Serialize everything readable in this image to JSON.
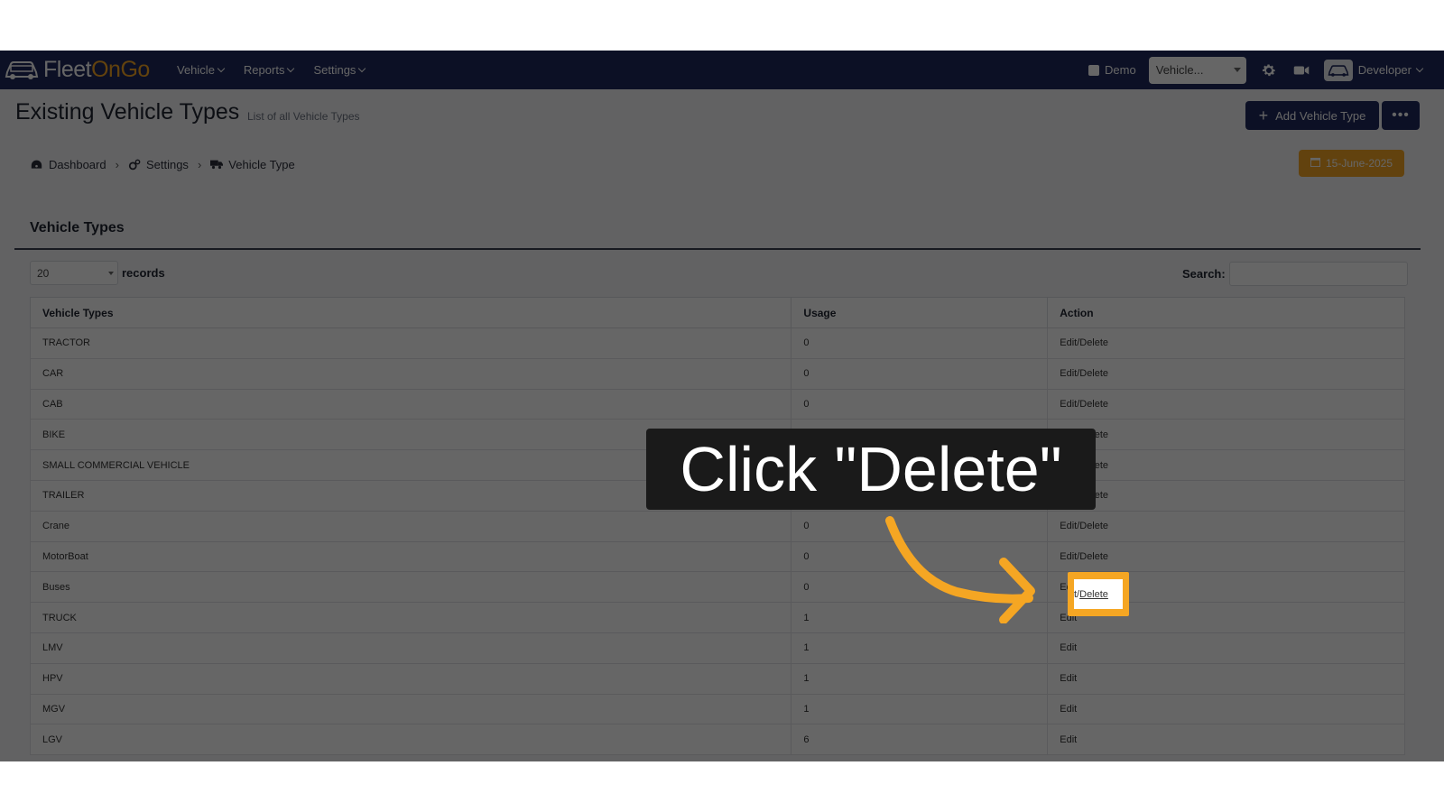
{
  "app": {
    "name_part1": "Fleet",
    "name_part2": "OnGo"
  },
  "nav": {
    "menu": [
      {
        "label": "Vehicle"
      },
      {
        "label": "Reports"
      },
      {
        "label": "Settings"
      }
    ],
    "demo_label": "Demo",
    "vehicle_select": "Vehicle...",
    "user": "Developer"
  },
  "page": {
    "title": "Existing Vehicle Types",
    "subtitle": "List of all Vehicle Types",
    "add_button": "Add Vehicle Type",
    "more_button": "•••",
    "date": "15-June-2025"
  },
  "breadcrumb": [
    {
      "label": "Dashboard"
    },
    {
      "label": "Settings"
    },
    {
      "label": "Vehicle Type"
    }
  ],
  "section": {
    "title": "Vehicle Types"
  },
  "records": {
    "value": "20",
    "label": "records"
  },
  "search": {
    "label": "Search:",
    "value": ""
  },
  "table": {
    "headers": [
      "Vehicle Types",
      "Usage",
      "Action"
    ],
    "rows": [
      [
        "TRACTOR",
        "0",
        "Edit/Delete"
      ],
      [
        "CAR",
        "0",
        "Edit/Delete"
      ],
      [
        "CAB",
        "0",
        "Edit/Delete"
      ],
      [
        "BIKE",
        "",
        "Edit/Delete"
      ],
      [
        "SMALL COMMERCIAL VEHICLE",
        "",
        "Edit/Delete"
      ],
      [
        "TRAILER",
        "",
        "Edit/Delete"
      ],
      [
        "Crane",
        "0",
        "Edit/Delete"
      ],
      [
        "MotorBoat",
        "0",
        "Edit/Delete"
      ],
      [
        "Buses",
        "0",
        "Edit/Delete"
      ],
      [
        "TRUCK",
        "1",
        "Edit"
      ],
      [
        "LMV",
        "1",
        "Edit"
      ],
      [
        "HPV",
        "1",
        "Edit"
      ],
      [
        "MGV",
        "1",
        "Edit"
      ],
      [
        "LGV",
        "6",
        "Edit"
      ]
    ]
  },
  "tutorial": {
    "callout": "Click \"Delete\"",
    "highlight_prefix": "t/",
    "highlight_link": "Delete",
    "accent_color": "#f5a623"
  }
}
